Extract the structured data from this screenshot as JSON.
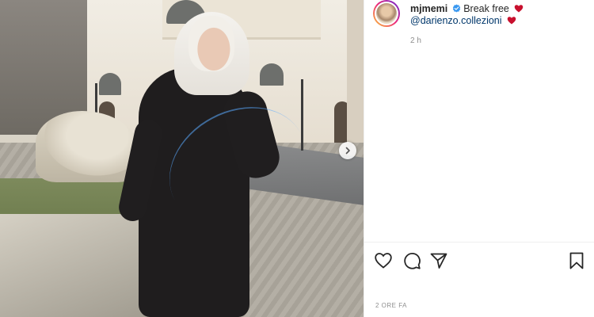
{
  "post": {
    "username": "mjmemi",
    "caption_text": "Break free",
    "mention": "@darienzo.collezioni",
    "time_ago": "2 h",
    "timestamp": "2 ORE FA"
  },
  "icons": {
    "verified": "verified-badge-icon",
    "heart": "red-heart-emoji",
    "like": "heart-outline-icon",
    "comment": "comment-bubble-icon",
    "share": "paper-plane-icon",
    "save": "bookmark-icon",
    "next": "chevron-right-icon"
  },
  "colors": {
    "verified": "#3897f0",
    "heart": "#c8102e",
    "mention": "#00376b",
    "text": "#262626",
    "muted": "#8e8e8e"
  }
}
